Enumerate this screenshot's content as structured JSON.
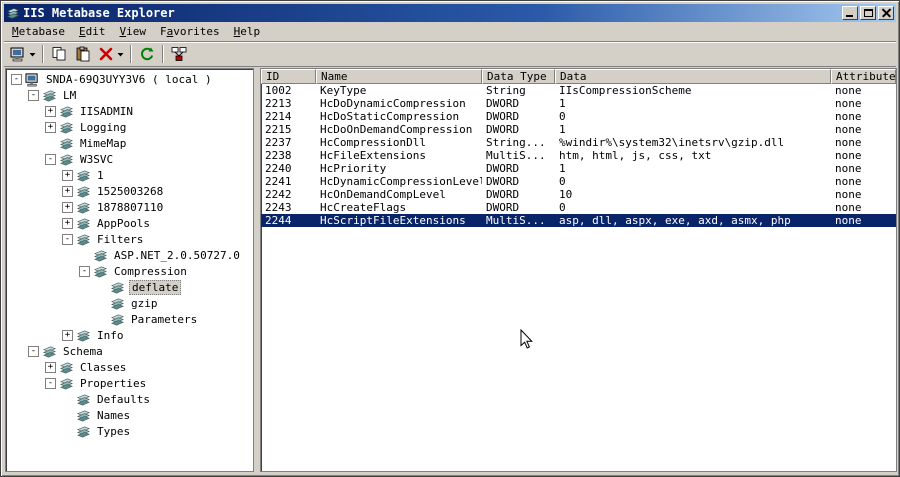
{
  "window": {
    "title": "IIS Metabase Explorer",
    "buttons": [
      "minimize",
      "maximize",
      "close"
    ]
  },
  "colors": {
    "titlebar_left": "#0a246a",
    "titlebar_right": "#a6caf0",
    "chrome": "#d4d0c8",
    "pane_bg": "#ffffff",
    "selection": "#0a246a",
    "selection_text": "#ffffff"
  },
  "menu": {
    "items": [
      {
        "label": "Metabase",
        "underline": 0
      },
      {
        "label": "Edit",
        "underline": 0
      },
      {
        "label": "View",
        "underline": 0
      },
      {
        "label": "Favorites",
        "underline": 1
      },
      {
        "label": "Help",
        "underline": 0
      }
    ]
  },
  "toolbar": {
    "buttons": [
      {
        "name": "connect-button",
        "icon": "computer",
        "dropdown": true
      },
      {
        "separator": true
      },
      {
        "name": "copy-button",
        "icon": "copy"
      },
      {
        "name": "paste-button",
        "icon": "paste"
      },
      {
        "name": "delete-button",
        "icon": "delete",
        "dropdown": true
      },
      {
        "separator": true
      },
      {
        "name": "refresh-button",
        "icon": "refresh"
      },
      {
        "separator": true
      },
      {
        "name": "network-button",
        "icon": "network"
      }
    ]
  },
  "tree": {
    "items": [
      {
        "label": "SNDA-69Q3UYY3V6 ( local )",
        "depth": 0,
        "toggle": "minus",
        "icon": "computer",
        "selected": false
      },
      {
        "label": "LM",
        "depth": 1,
        "toggle": "minus",
        "icon": "node",
        "selected": false
      },
      {
        "label": "IISADMIN",
        "depth": 2,
        "toggle": "plus",
        "icon": "node",
        "selected": false
      },
      {
        "label": "Logging",
        "depth": 2,
        "toggle": "plus",
        "icon": "node",
        "selected": false
      },
      {
        "label": "MimeMap",
        "depth": 2,
        "toggle": "none",
        "icon": "node",
        "selected": false
      },
      {
        "label": "W3SVC",
        "depth": 2,
        "toggle": "minus",
        "icon": "node",
        "selected": false
      },
      {
        "label": "1",
        "depth": 3,
        "toggle": "plus",
        "icon": "node",
        "selected": false
      },
      {
        "label": "1525003268",
        "depth": 3,
        "toggle": "plus",
        "icon": "node",
        "selected": false
      },
      {
        "label": "1878807110",
        "depth": 3,
        "toggle": "plus",
        "icon": "node",
        "selected": false
      },
      {
        "label": "AppPools",
        "depth": 3,
        "toggle": "plus",
        "icon": "node",
        "selected": false
      },
      {
        "label": "Filters",
        "depth": 3,
        "toggle": "minus",
        "icon": "node",
        "selected": false
      },
      {
        "label": "ASP.NET_2.0.50727.0",
        "depth": 4,
        "toggle": "none",
        "icon": "node",
        "selected": false
      },
      {
        "label": "Compression",
        "depth": 4,
        "toggle": "minus",
        "icon": "node",
        "selected": false
      },
      {
        "label": "deflate",
        "depth": 5,
        "toggle": "none",
        "icon": "node",
        "selected": true
      },
      {
        "label": "gzip",
        "depth": 5,
        "toggle": "none",
        "icon": "node",
        "selected": false
      },
      {
        "label": "Parameters",
        "depth": 5,
        "toggle": "none",
        "icon": "node",
        "selected": false
      },
      {
        "label": "Info",
        "depth": 3,
        "toggle": "plus",
        "icon": "node",
        "selected": false
      },
      {
        "label": "Schema",
        "depth": 1,
        "toggle": "minus",
        "icon": "node",
        "selected": false
      },
      {
        "label": "Classes",
        "depth": 2,
        "toggle": "plus",
        "icon": "node",
        "selected": false
      },
      {
        "label": "Properties",
        "depth": 2,
        "toggle": "minus",
        "icon": "node",
        "selected": false
      },
      {
        "label": "Defaults",
        "depth": 3,
        "toggle": "none",
        "icon": "node",
        "selected": false
      },
      {
        "label": "Names",
        "depth": 3,
        "toggle": "none",
        "icon": "node",
        "selected": false
      },
      {
        "label": "Types",
        "depth": 3,
        "toggle": "none",
        "icon": "node",
        "selected": false
      }
    ]
  },
  "list": {
    "columns": [
      "ID",
      "Name",
      "Data Type",
      "Data",
      "Attributes"
    ],
    "rows": [
      {
        "id": "1002",
        "name": "KeyType",
        "type": "String",
        "data": "IIsCompressionScheme",
        "attrs": "none",
        "selected": false
      },
      {
        "id": "2213",
        "name": "HcDoDynamicCompression",
        "type": "DWORD",
        "data": "1",
        "attrs": "none",
        "selected": false
      },
      {
        "id": "2214",
        "name": "HcDoStaticCompression",
        "type": "DWORD",
        "data": "0",
        "attrs": "none",
        "selected": false
      },
      {
        "id": "2215",
        "name": "HcDoOnDemandCompression",
        "type": "DWORD",
        "data": "1",
        "attrs": "none",
        "selected": false
      },
      {
        "id": "2237",
        "name": "HcCompressionDll",
        "type": "String...",
        "data": "%windir%\\system32\\inetsrv\\gzip.dll",
        "attrs": "none",
        "selected": false
      },
      {
        "id": "2238",
        "name": "HcFileExtensions",
        "type": "MultiS...",
        "data": "htm, html, js, css, txt",
        "attrs": "none",
        "selected": false
      },
      {
        "id": "2240",
        "name": "HcPriority",
        "type": "DWORD",
        "data": "1",
        "attrs": "none",
        "selected": false
      },
      {
        "id": "2241",
        "name": "HcDynamicCompressionLevel",
        "type": "DWORD",
        "data": "0",
        "attrs": "none",
        "selected": false
      },
      {
        "id": "2242",
        "name": "HcOnDemandCompLevel",
        "type": "DWORD",
        "data": "10",
        "attrs": "none",
        "selected": false
      },
      {
        "id": "2243",
        "name": "HcCreateFlags",
        "type": "DWORD",
        "data": "0",
        "attrs": "none",
        "selected": false
      },
      {
        "id": "2244",
        "name": "HcScriptFileExtensions",
        "type": "MultiS...",
        "data": "asp, dll, aspx, exe, axd, asmx, php",
        "attrs": "none",
        "selected": true
      }
    ]
  }
}
